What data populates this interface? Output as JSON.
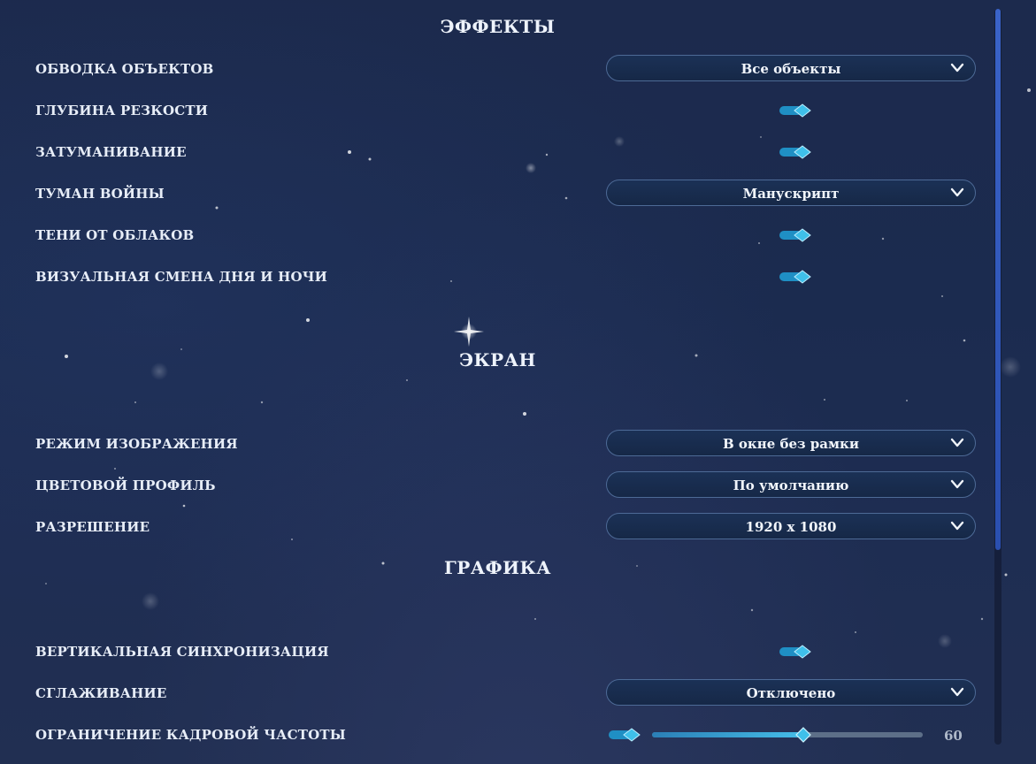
{
  "sections": {
    "effects": {
      "title": "ЭФФЕКТЫ",
      "rows": [
        {
          "label": "ОБВОДКА ОБЪЕКТОВ",
          "control": "dropdown",
          "value": "Все объекты"
        },
        {
          "label": "ГЛУБИНА РЕЗКОСТИ",
          "control": "toggle",
          "state": "on"
        },
        {
          "label": "ЗАТУМАНИВАНИЕ",
          "control": "toggle",
          "state": "on"
        },
        {
          "label": "ТУМАН ВОЙНЫ",
          "control": "dropdown",
          "value": "Манускрипт"
        },
        {
          "label": "ТЕНИ ОТ ОБЛАКОВ",
          "control": "toggle",
          "state": "on"
        },
        {
          "label": "ВИЗУАЛЬНАЯ СМЕНА ДНЯ И НОЧИ",
          "control": "toggle",
          "state": "on"
        }
      ]
    },
    "screen": {
      "title": "ЭКРАН",
      "rows": [
        {
          "label": "РЕЖИМ ИЗОБРАЖЕНИЯ",
          "control": "dropdown",
          "value": "В окне без рамки"
        },
        {
          "label": "ЦВЕТОВОЙ ПРОФИЛЬ",
          "control": "dropdown",
          "value": "По умолчанию"
        },
        {
          "label": "РАЗРЕШЕНИЕ",
          "control": "dropdown",
          "value": "1920 x 1080"
        }
      ]
    },
    "graphics": {
      "title": "ГРАФИКА",
      "rows": [
        {
          "label": "ВЕРТИКАЛЬНАЯ СИНХРОНИЗАЦИЯ",
          "control": "toggle",
          "state": "on"
        },
        {
          "label": "СГЛАЖИВАНИЕ",
          "control": "dropdown",
          "value": "Отключено"
        },
        {
          "label": "ОГРАНИЧЕНИЕ КАДРОВОЙ ЧАСТОТЫ",
          "control": "toggle-slider",
          "state": "on",
          "slider_value": "60",
          "slider_fraction": 0.56
        }
      ]
    }
  },
  "colors": {
    "accent": "#3fc0ea",
    "accent_dark": "#1f8fc4",
    "scrollbar": "#3a63c8",
    "background": "#1c2a4d"
  },
  "icons": {
    "dropdown": "chevron-down-icon",
    "toggle": "diamond-toggle-icon"
  },
  "scroll_position_fraction": 0.0
}
